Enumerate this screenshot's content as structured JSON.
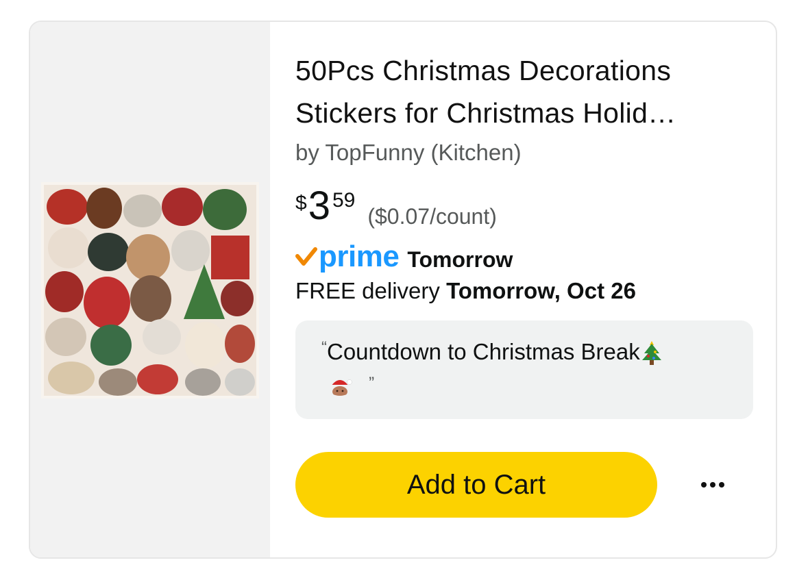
{
  "product": {
    "title_line1": "50Pcs Christmas Decorations",
    "title_line2": "Stickers for Christmas Holid…",
    "byline": "by TopFunny (Kitchen)",
    "image_icon": "christmas-stickers-product-image"
  },
  "price": {
    "symbol": "$",
    "whole": "3",
    "fraction": "59",
    "unit_price": "($0.07/count)"
  },
  "delivery": {
    "prime_label": "prime",
    "prime_speed": "Tomorrow",
    "free_prefix": "FREE delivery ",
    "date": "Tomorrow, Oct 26",
    "prime_color": "#1a98ff",
    "prime_check_color": "#f08804"
  },
  "review": {
    "open_quote": "“",
    "text": "Countdown to Christmas Break",
    "close_quote": "”",
    "emoji_1": "christmas-tree-icon",
    "emoji_2": "santa-icon"
  },
  "actions": {
    "add_to_cart_label": "Add to Cart",
    "add_to_cart_color": "#fcd200",
    "more_icon": "more-options-icon"
  }
}
